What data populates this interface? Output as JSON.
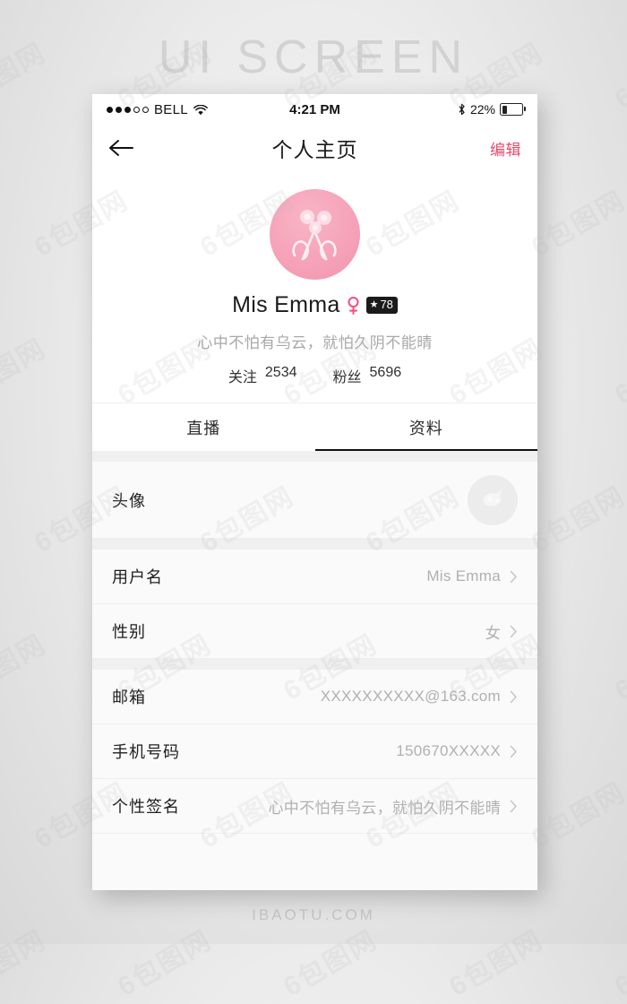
{
  "page": {
    "header_watermark": "UI SCREEN",
    "footer_watermark": "IBAOTU.COM",
    "watermark_tile": "6包图网"
  },
  "statusbar": {
    "carrier": "BELL",
    "time": "4:21 PM",
    "battery_percent": "22%",
    "signal_dots_filled": 3,
    "signal_dots_total": 5,
    "wifi_icon": "wifi-icon",
    "bluetooth_icon": "bluetooth-icon",
    "battery_icon": "battery-icon"
  },
  "navbar": {
    "back_icon": "arrow-left-icon",
    "title": "个人主页",
    "edit_label": "编辑",
    "edit_color": "#e8486a"
  },
  "profile": {
    "avatar_icon": "avatar-image",
    "name": "Mis Emma",
    "gender_icon": "female-icon",
    "gender_color": "#ef4f7e",
    "level_star": "★",
    "level": "78",
    "bio": "心中不怕有乌云，就怕久阴不能晴",
    "stats": [
      {
        "label": "关注",
        "value": "2534"
      },
      {
        "label": "粉丝",
        "value": "5696"
      }
    ]
  },
  "tabs": [
    {
      "label": "直播",
      "active": false
    },
    {
      "label": "资料",
      "active": true
    }
  ],
  "settings": {
    "rows": [
      {
        "label": "头像",
        "value": "",
        "type": "avatar"
      },
      {
        "label": "用户名",
        "value": "Mis Emma",
        "type": "text"
      },
      {
        "label": "性别",
        "value": "女",
        "type": "text"
      },
      {
        "label": "邮箱",
        "value": "XXXXXXXXXX@163.com",
        "type": "text"
      },
      {
        "label": "手机号码",
        "value": "150670XXXXX",
        "type": "text"
      },
      {
        "label": "个性签名",
        "value": "心中不怕有乌云，就怕久阴不能晴",
        "type": "text"
      }
    ],
    "chevron_icon": "chevron-right-icon"
  }
}
